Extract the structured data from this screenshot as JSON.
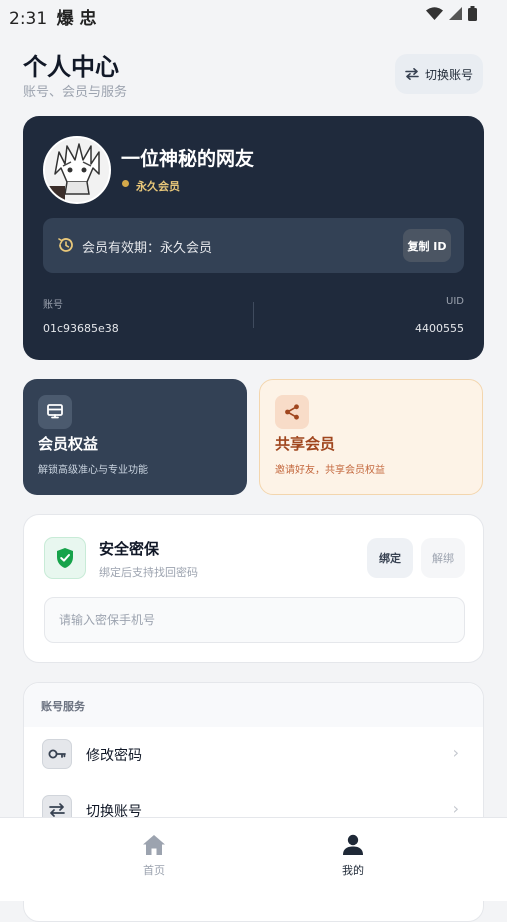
{
  "status_bar": {
    "time": "2:31",
    "app_glyphs": "爆 忠"
  },
  "header": {
    "title": "个人中心",
    "subtitle": "账号、会员与服务",
    "switch_account_label": "切换账号"
  },
  "profile": {
    "nickname": "一位神秘的网友",
    "vip_badge": "永久会员",
    "validity_text": "会员有效期：永久会员",
    "copy_id_label": "复制 ID",
    "account_label": "账号",
    "account_value": "01c93685e38",
    "uid_label": "UID",
    "uid_value": "4400555"
  },
  "benefits": {
    "member": {
      "title": "会员权益",
      "subtitle": "解锁高级准心与专业功能"
    },
    "share": {
      "title": "共享会员",
      "subtitle": "邀请好友，共享会员权益"
    }
  },
  "security": {
    "title": "安全密保",
    "subtitle": "绑定后支持找回密码",
    "bind_label": "绑定",
    "unbind_label": "解绑",
    "phone_placeholder": "请输入密保手机号",
    "phone_value": ""
  },
  "services": {
    "title": "账号服务",
    "items": [
      {
        "label": "修改密码",
        "icon": "key-icon"
      },
      {
        "label": "切换账号",
        "icon": "swap-icon"
      }
    ]
  },
  "bottom_nav": [
    {
      "label": "首页",
      "icon": "home-icon",
      "active": false
    },
    {
      "label": "我的",
      "icon": "user-icon",
      "active": true
    }
  ],
  "colors": {
    "card_dark": "#1f2a3c",
    "gold": "#d4a94a",
    "share_accent": "#a0461e",
    "shield_green": "#16a34a"
  }
}
